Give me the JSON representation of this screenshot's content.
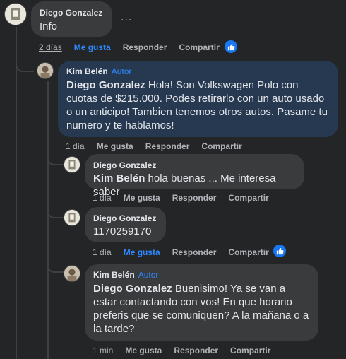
{
  "comments": [
    {
      "author": "Diego Gonzalez",
      "text": "Info",
      "time": "2 días",
      "like": "Me gusta",
      "reply": "Responder",
      "share": "Compartir",
      "more": "..."
    },
    {
      "author": "Kim Belén",
      "badge": "Autor",
      "mention": "Diego Gonzalez",
      "text": " Hola! Son Volkswagen Polo con cuotas de $215.000. Podes retirarlo con un auto usado o un anticipo! Tambien tenemos otros autos. Pasame tu numero y te hablamos!",
      "time": "1 día",
      "like": "Me gusta",
      "reply": "Responder",
      "share": "Compartir"
    },
    {
      "author": "Diego Gonzalez",
      "mention": "Kim Belén",
      "text": " hola buenas ... Me interesa saber",
      "time": "1 día",
      "like": "Me gusta",
      "reply": "Responder",
      "share": "Compartir"
    },
    {
      "author": "Diego Gonzalez",
      "text": "1170259170",
      "time": "1 día",
      "like": "Me gusta",
      "reply": "Responder",
      "share": "Compartir"
    },
    {
      "author": "Kim Belén",
      "badge": "Autor",
      "mention": "Diego Gonzalez",
      "text": " Buenisimo! Ya se van a estar contactando con vos! En que horario preferis que se comuniquen? A la mañana o a la tarde?",
      "time": "1 min",
      "like": "Me gusta",
      "reply": "Responder",
      "share": "Compartir"
    }
  ],
  "colors": {
    "background": "#242526",
    "bubble": "#3a3b3c",
    "highlight": "#263951",
    "accent": "#2d88ff"
  }
}
